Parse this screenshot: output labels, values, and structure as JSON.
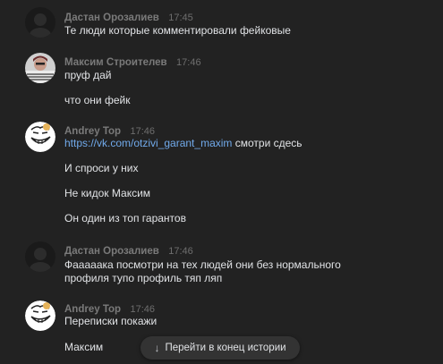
{
  "messages": [
    {
      "author": "Дастан Орозалиев",
      "time": "17:45",
      "avatar": "dark-avatar",
      "lines": [
        "Те люди которые комментировали фейковые"
      ]
    },
    {
      "author": "Максим Строителев",
      "time": "17:46",
      "avatar": "photo-avatar",
      "lines": [
        "пруф дай",
        "что они фейк"
      ]
    },
    {
      "author": "Andrey Top",
      "time": "17:46",
      "avatar": "troll-face-avatar",
      "link": "https://vk.com/otzivi_garant_maxim",
      "link_suffix": " смотри сдесь",
      "lines": [
        "И спроси у них",
        "Не кидок Максим",
        "Он один из топ гарантов"
      ]
    },
    {
      "author": "Дастан Орозалиев",
      "time": "17:46",
      "avatar": "dark-avatar",
      "lines": [
        "Фааааака посмотри на тех людей они без нормального",
        "профиля тупо профиль тяп ляп"
      ]
    },
    {
      "author": "Andrey Top",
      "time": "17:46",
      "avatar": "troll-face-avatar",
      "lines": [
        "Переписки покажи",
        "Максим"
      ]
    }
  ],
  "scroll_button": {
    "arrow": "↓",
    "label": "Перейти в конец истории"
  },
  "colors": {
    "background": "#222222",
    "link": "#71aaeb",
    "text": "#e1e3e6",
    "author": "#7a7a7a"
  }
}
